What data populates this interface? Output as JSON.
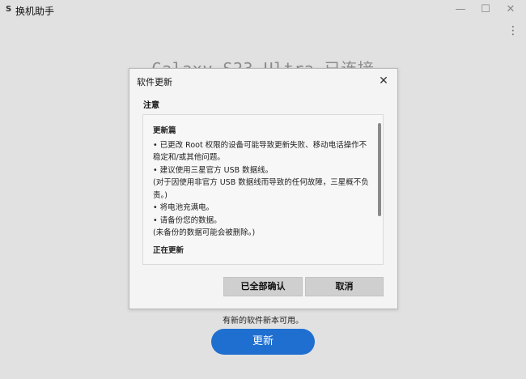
{
  "window": {
    "app_icon": "S",
    "title": "换机助手",
    "minimize_glyph": "—",
    "maximize_glyph": "☐",
    "close_glyph": "✕",
    "more_glyph": "⋮"
  },
  "main": {
    "device_title": "Galaxy S23 Ultra 已连接",
    "update_note": "有新的软件新本可用。",
    "update_button": "更新"
  },
  "dialog": {
    "title": "软件更新",
    "close_glyph": "✕",
    "notice_label": "注意",
    "content": {
      "heading": "更新篇",
      "lines": [
        "• 已更改 Root 权限的设备可能导致更新失败、移动电话操作不稳定和/或其他问题。",
        "• 建议使用三星官方 USB 数据线。",
        "(对于因使用非官方 USB 数据线而导致的任何故障，三星概不负责。)",
        "• 将电池充满电。",
        "• 请备份您的数据。",
        "(未备份的数据可能会被删除。)"
      ],
      "heading2": "正在更新"
    },
    "ok_button": "已全部确认",
    "cancel_button": "取消"
  }
}
